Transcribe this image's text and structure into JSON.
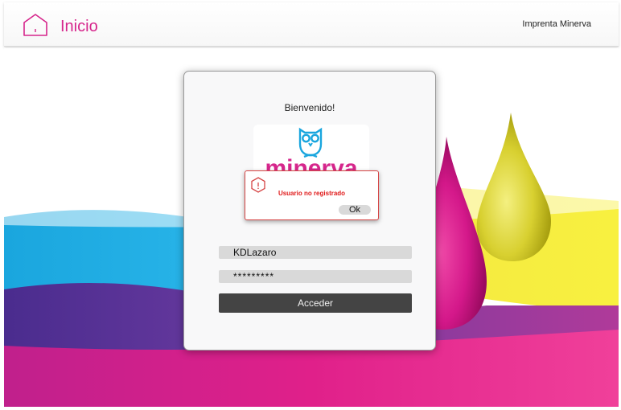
{
  "header": {
    "title": "Inicio",
    "brand": "Imprenta Minerva",
    "accent_color": "#d6268c",
    "home_icon": "home-icon"
  },
  "login": {
    "welcome": "Bienvenido!",
    "logo_text": "minerva",
    "logo_icon": "owl-logo-icon",
    "username_value": "KDLazaro",
    "password_value": "*********",
    "submit_label": "Acceder"
  },
  "alert": {
    "message": "Usuario no registrado",
    "ok_label": "Ok",
    "icon": "warning-icon",
    "color": "#e01a1a"
  }
}
